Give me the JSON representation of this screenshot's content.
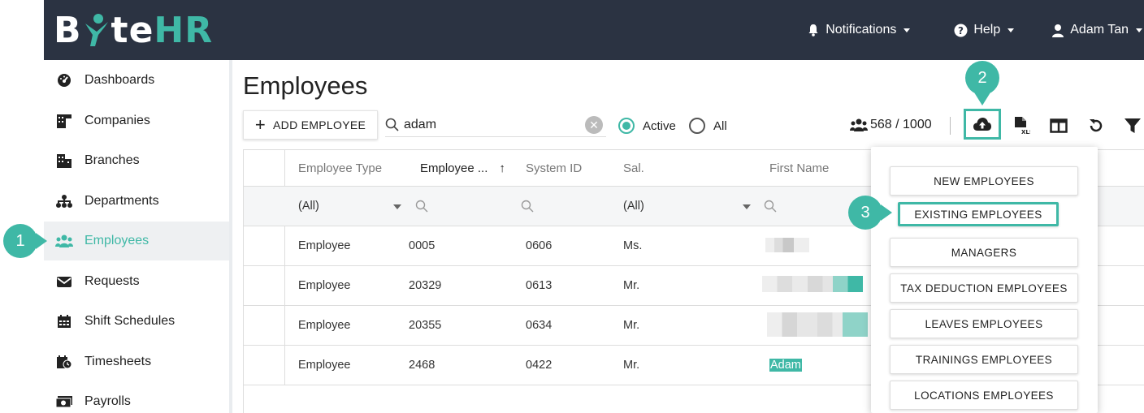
{
  "app": {
    "logo": {
      "part1": "B",
      "part2": "te",
      "part3": "HR"
    }
  },
  "topnav": {
    "notifications": "Notifications",
    "help": "Help",
    "user": "Adam Tan"
  },
  "sidebar": {
    "items": [
      {
        "label": "Dashboards",
        "icon": "dashboard-icon"
      },
      {
        "label": "Companies",
        "icon": "companies-icon"
      },
      {
        "label": "Branches",
        "icon": "branches-icon"
      },
      {
        "label": "Departments",
        "icon": "departments-icon"
      },
      {
        "label": "Employees",
        "icon": "employees-icon",
        "active": true
      },
      {
        "label": "Requests",
        "icon": "requests-icon"
      },
      {
        "label": "Shift Schedules",
        "icon": "calendar-icon"
      },
      {
        "label": "Timesheets",
        "icon": "timesheet-icon"
      },
      {
        "label": "Payrolls",
        "icon": "payroll-icon"
      }
    ]
  },
  "callouts": {
    "one": "1",
    "two": "2",
    "three": "3"
  },
  "main": {
    "title": "Employees",
    "add_button": "ADD EMPLOYEE",
    "search_value": "adam",
    "filter_active": "Active",
    "filter_all": "All",
    "count": "568 / 1000"
  },
  "grid": {
    "columns": [
      "Employee Type",
      "Employee ...",
      "System ID",
      "Sal.",
      "First Name"
    ],
    "sort_indicator": "↑",
    "filter_values": {
      "employee_type": "(All)",
      "salutation": "(All)"
    },
    "rows": [
      {
        "type": "Employee",
        "emp_no": "0005",
        "system_id": "0606",
        "sal": "Ms.",
        "first_name": ""
      },
      {
        "type": "Employee",
        "emp_no": "20329",
        "system_id": "0613",
        "sal": "Mr.",
        "first_name": ""
      },
      {
        "type": "Employee",
        "emp_no": "20355",
        "system_id": "0634",
        "sal": "Mr.",
        "first_name": ""
      },
      {
        "type": "Employee",
        "emp_no": "2468",
        "system_id": "0422",
        "sal": "Mr.",
        "first_name": "Adam"
      }
    ]
  },
  "import_menu": {
    "items": [
      "NEW EMPLOYEES",
      "EXISTING EMPLOYEES",
      "MANAGERS",
      "TAX DEDUCTION EMPLOYEES",
      "LEAVES EMPLOYEES",
      "TRAININGS EMPLOYEES",
      "LOCATIONS EMPLOYEES"
    ]
  },
  "colors": {
    "accent": "#3fb8a6",
    "topbar": "#2b3342"
  }
}
